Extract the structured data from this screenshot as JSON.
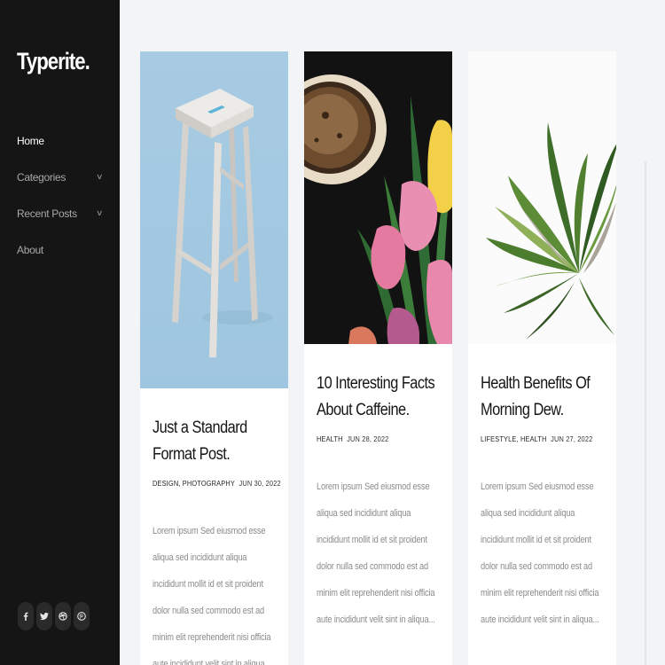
{
  "site": {
    "logo": "Typerite."
  },
  "nav": [
    {
      "label": "Home",
      "active": true,
      "has_dropdown": false
    },
    {
      "label": "Categories",
      "active": false,
      "has_dropdown": true
    },
    {
      "label": "Recent Posts",
      "active": false,
      "has_dropdown": true
    },
    {
      "label": "About",
      "active": false,
      "has_dropdown": false
    }
  ],
  "social": [
    {
      "icon": "facebook-icon",
      "glyph": "f"
    },
    {
      "icon": "twitter-icon",
      "glyph": "t"
    },
    {
      "icon": "dribbble-icon",
      "glyph": "d"
    },
    {
      "icon": "pinterest-icon",
      "glyph": "p"
    }
  ],
  "posts": [
    {
      "title": "Just a Standard Format Post.",
      "categories": "Design, Photography",
      "date": "Jun 30, 2022",
      "excerpt": "Lorem ipsum Sed eiusmod esse aliqua sed incididunt aliqua incididunt mollit id et sit proident dolor nulla sed commodo est ad minim elit reprehenderit nisi officia aute incididunt velit sint in aliqua...",
      "image": "stool"
    },
    {
      "title": "10 Interesting Facts About Caffeine.",
      "categories": "Health",
      "date": "Jun 28, 2022",
      "excerpt": "Lorem ipsum Sed eiusmod esse aliqua sed incididunt aliqua incididunt mollit id et sit proident dolor nulla sed commodo est ad minim elit reprehenderit nisi officia aute incididunt velit sint in aliqua...",
      "image": "coffee-tulips"
    },
    {
      "title": "Health Benefits Of Morning Dew.",
      "categories": "Lifestyle, Health",
      "date": "Jun 27, 2022",
      "excerpt": "Lorem ipsum Sed eiusmod esse aliqua sed incididunt aliqua incididunt mollit id et sit proident dolor nulla sed commodo est ad minim elit reprehenderit nisi officia aute incididunt velit sint in aliqua...",
      "image": "plant"
    }
  ],
  "colors": {
    "sidebar": "#151515",
    "page_bg": "#f3f4f6",
    "card_bg": "#ffffff",
    "stool_bg": "#a9cde4"
  }
}
